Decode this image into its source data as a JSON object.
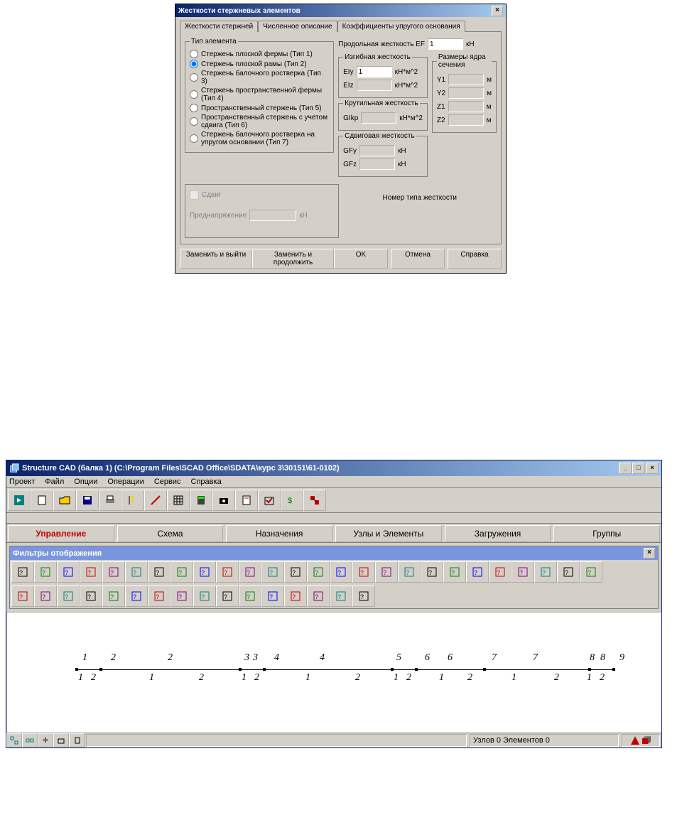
{
  "dialog": {
    "title": "Жесткости стержневых элементов",
    "tabs": [
      "Жесткости стержней",
      "Численное описание",
      "Коэффициенты упругого основания"
    ],
    "active_tab": 1,
    "group_type": "Тип элемента",
    "types": [
      "Стержень плоской фермы (Тип 1)",
      "Стержень плоской рамы (Тип 2)",
      "Стержень балочного ростверка (Тип 3)",
      "Стержень пространственной фермы (Тип 4)",
      "Пространственный стержень (Тип 5)",
      "Пространственный стержень с учетом сдвига (Тип 6)",
      "Стержень балочного ростверка на упругом основании (Тип 7)"
    ],
    "selected_type": 1,
    "ef_label": "Продольная жесткость EF",
    "ef_value": "1",
    "ef_unit": "кН",
    "bending": "Изгибная жесткость",
    "ely_label": "EIy",
    "ely_value": "1",
    "ely_unit": "кН*м^2",
    "elz_label": "EIz",
    "elz_value": "",
    "elz_unit": "кН*м^2",
    "torsion": "Крутильная жесткость",
    "gik_label": "GIkp",
    "gik_value": "",
    "gik_unit": "кН*м^2",
    "shear": "Сдвиговая жесткость",
    "gfy_label": "GFy",
    "gfy_unit": "кН",
    "gfz_label": "GFz",
    "gfz_unit": "кН",
    "core": "Размеры ядра сечения",
    "y1_label": "Y1",
    "y2_label": "Y2",
    "z1_label": "Z1",
    "z2_label": "Z2",
    "m_unit": "м",
    "shift": "Сдвиг",
    "prestress": "Преднапряжение",
    "prestress_unit": "кН",
    "stiff_num": "Номер типа жесткости",
    "btn_replace_exit": "Заменить и выйти",
    "btn_replace_cont": "Заменить и продолжить",
    "btn_ok": "OK",
    "btn_cancel": "Отмена",
    "btn_help": "Справка"
  },
  "app": {
    "title": "Structure CAD (балка 1) (C:\\Program Files\\SCAD Office\\SDATA\\курс 3\\30151\\61-0102)",
    "menu": [
      "Проект",
      "Файл",
      "Опции",
      "Операции",
      "Сервис",
      "Справка"
    ],
    "tabs": [
      "Управление",
      "Схема",
      "Назначения",
      "Узлы и Элементы",
      "Загружения",
      "Группы"
    ],
    "active_tab": 0,
    "filter_title": "Фильтры отображения",
    "status": "Узлов 0 Элементов 0",
    "toolbar_icons": [
      "exit",
      "new",
      "open",
      "save",
      "print",
      "tree",
      "pencil",
      "grid",
      "calc",
      "camera",
      "props",
      "check",
      "s-props",
      "export"
    ],
    "filter_row1": [
      "shape1",
      "shape2",
      "shape3",
      "stack",
      "q-i",
      "q-x",
      "q-ne",
      "q-x2",
      "q-nj",
      "q-te",
      "q-r",
      "q-sq",
      "arrows",
      "axis1",
      "axis2",
      "axis3",
      "q-z",
      "q-pin",
      "q-down",
      "q-f",
      "q-sp",
      "q-m",
      "hatch",
      "q-dots",
      "q-sq2",
      "grid2"
    ],
    "filter_row2": [
      "f1",
      "f2",
      "f3",
      "f4",
      "f5",
      "f6",
      "f7",
      "f8",
      "f9",
      "f10",
      "f11",
      "f12",
      "f13",
      "f14",
      "f15",
      "f16"
    ],
    "beam_top": [
      "1",
      "2",
      "2",
      "3 3",
      "4",
      "4",
      "5",
      "6",
      "6",
      "7",
      "7",
      "8 8",
      "9"
    ],
    "beam_bot": [
      "1 2",
      "1",
      "2",
      "1 2",
      "1",
      "2",
      "1 2",
      "1",
      "2",
      "1",
      "2",
      "1 2"
    ]
  }
}
